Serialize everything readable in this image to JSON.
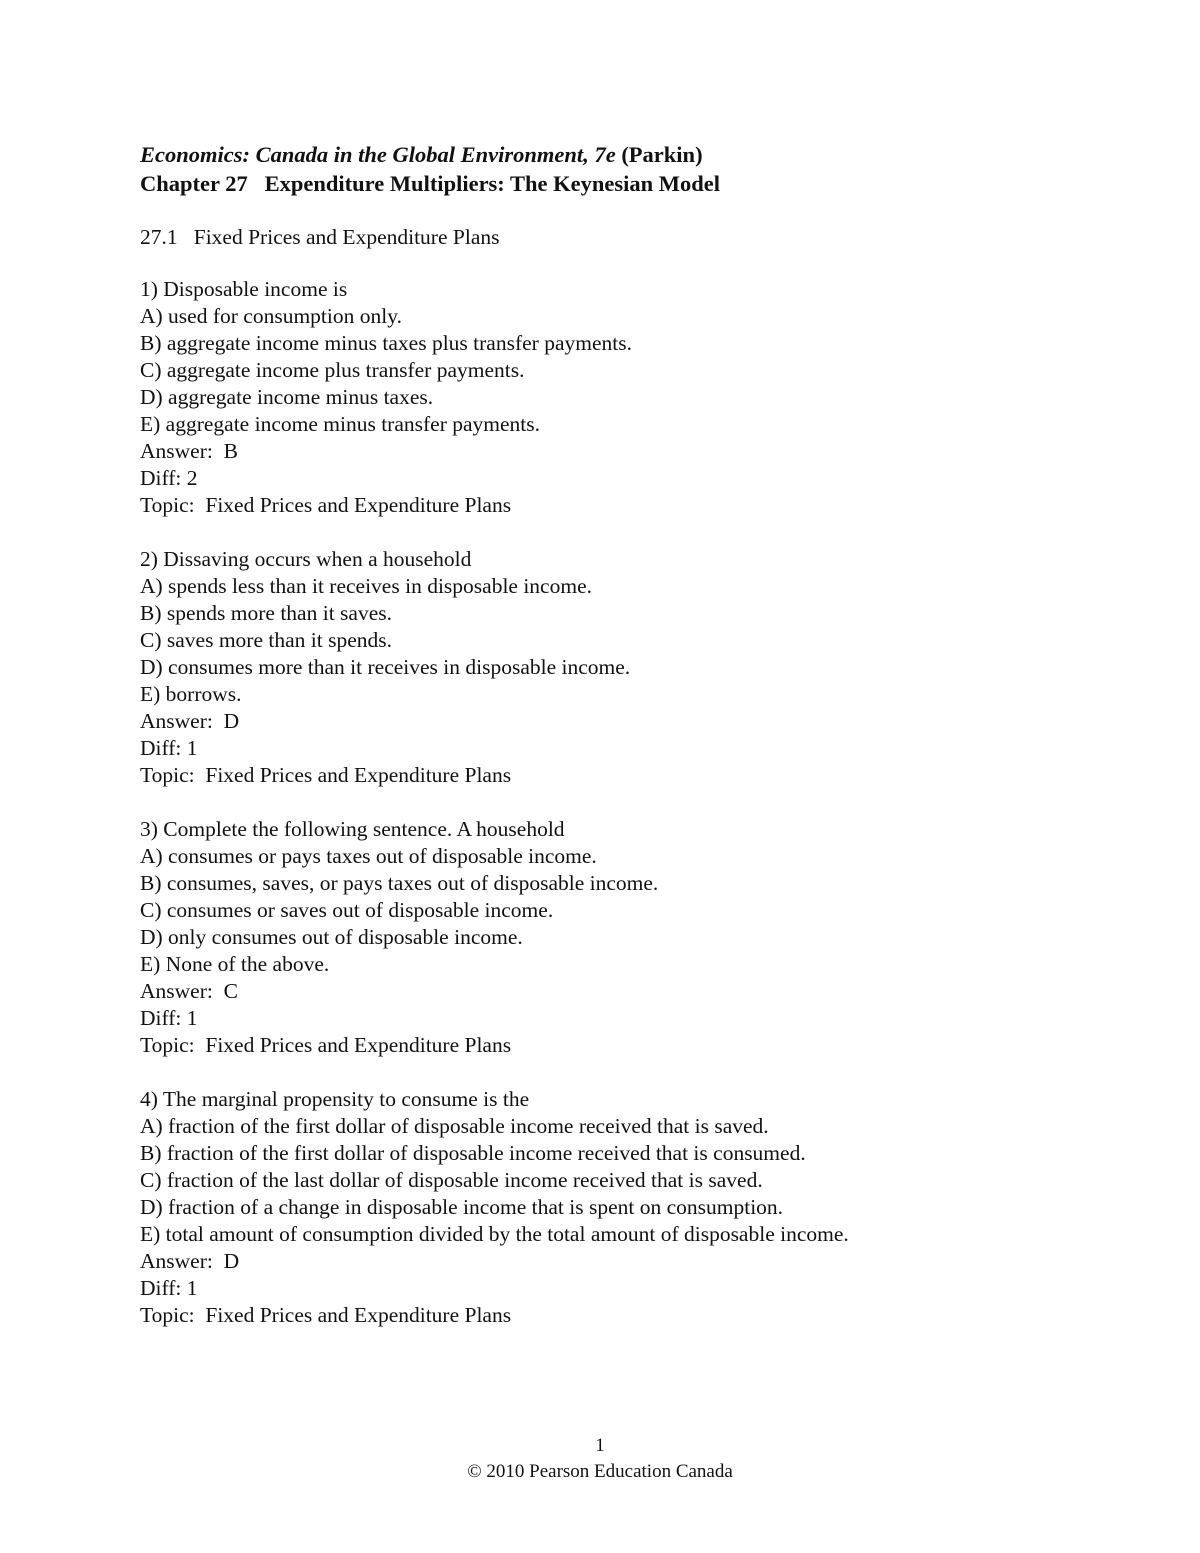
{
  "header": {
    "book_title_italic": "Economics: Canada in the Global Environment, 7e",
    "book_author": " (Parkin)",
    "chapter": "Chapter 27   Expenditure Multipliers: The Keynesian Model"
  },
  "section": {
    "number": "27.1",
    "title": "Fixed Prices and Expenditure Plans",
    "label": "27.1   Fixed Prices and Expenditure Plans"
  },
  "questions": [
    {
      "stem": "1) Disposable income is",
      "options": [
        "A) used for consumption only.",
        "B) aggregate income minus taxes plus transfer payments.",
        "C) aggregate income plus transfer payments.",
        "D) aggregate income minus taxes.",
        "E) aggregate income minus transfer payments."
      ],
      "answer": "Answer:  B",
      "diff": "Diff: 2",
      "topic": "Topic:  Fixed Prices and Expenditure Plans"
    },
    {
      "stem": "2) Dissaving occurs when a household",
      "options": [
        "A) spends less than it receives in disposable income.",
        "B) spends more than it saves.",
        "C) saves more than it spends.",
        "D) consumes more than it receives in disposable income.",
        "E) borrows."
      ],
      "answer": "Answer:  D",
      "diff": "Diff: 1",
      "topic": "Topic:  Fixed Prices and Expenditure Plans"
    },
    {
      "stem": "3) Complete the following sentence. A household",
      "options": [
        "A) consumes or pays taxes out of disposable income.",
        "B) consumes, saves, or pays taxes out of disposable income.",
        "C) consumes or saves out of disposable income.",
        "D) only consumes out of disposable income.",
        "E) None of the above."
      ],
      "answer": "Answer:  C",
      "diff": "Diff: 1",
      "topic": "Topic:  Fixed Prices and Expenditure Plans"
    },
    {
      "stem": "4) The marginal propensity to consume is the",
      "options": [
        "A) fraction of the first dollar of disposable income received that is saved.",
        "B) fraction of the first dollar of disposable income received that is consumed.",
        "C) fraction of the last dollar of disposable income received that is saved.",
        "D) fraction of a change in disposable income that is spent on consumption.",
        "E) total amount of consumption divided by the total amount of disposable income."
      ],
      "answer": "Answer:  D",
      "diff": "Diff: 1",
      "topic": "Topic:  Fixed Prices and Expenditure Plans"
    }
  ],
  "footer": {
    "page_number": "1",
    "copyright": "© 2010 Pearson Education Canada"
  }
}
